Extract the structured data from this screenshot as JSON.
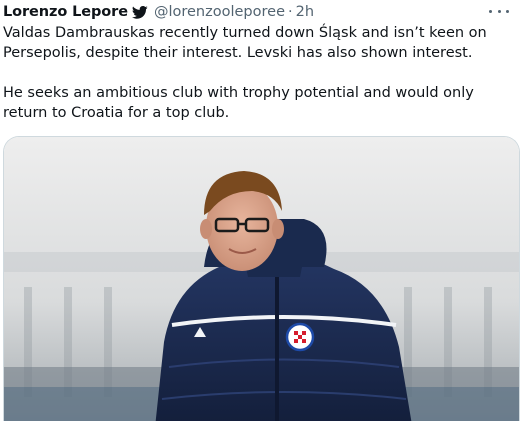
{
  "tweet": {
    "author_name": "Lorenzo Lepore",
    "verified_icon": "twitter-bird-icon",
    "handle": "@lorenzooleporee",
    "separator": "·",
    "time": "2h",
    "more_icon": "more-options-icon",
    "paragraphs": [
      "Valdas Dambrauskas recently turned down Śląsk and isn’t keen on Persepolis, despite their interest. Levski has also shown interest.",
      "He seeks an ambitious club with trophy potential and would only return to Croatia for a top club."
    ]
  },
  "media": {
    "image_icon": "photo-of-man-in-jacket",
    "colors": {
      "jacket": "#1c2b4f",
      "background": "#d9dbdc",
      "club_badge_red": "#d61c2c",
      "club_badge_blue": "#1d4aa8"
    }
  },
  "colors": {
    "text": "#0f1419",
    "secondary": "#536471",
    "border": "#cfd9de"
  }
}
